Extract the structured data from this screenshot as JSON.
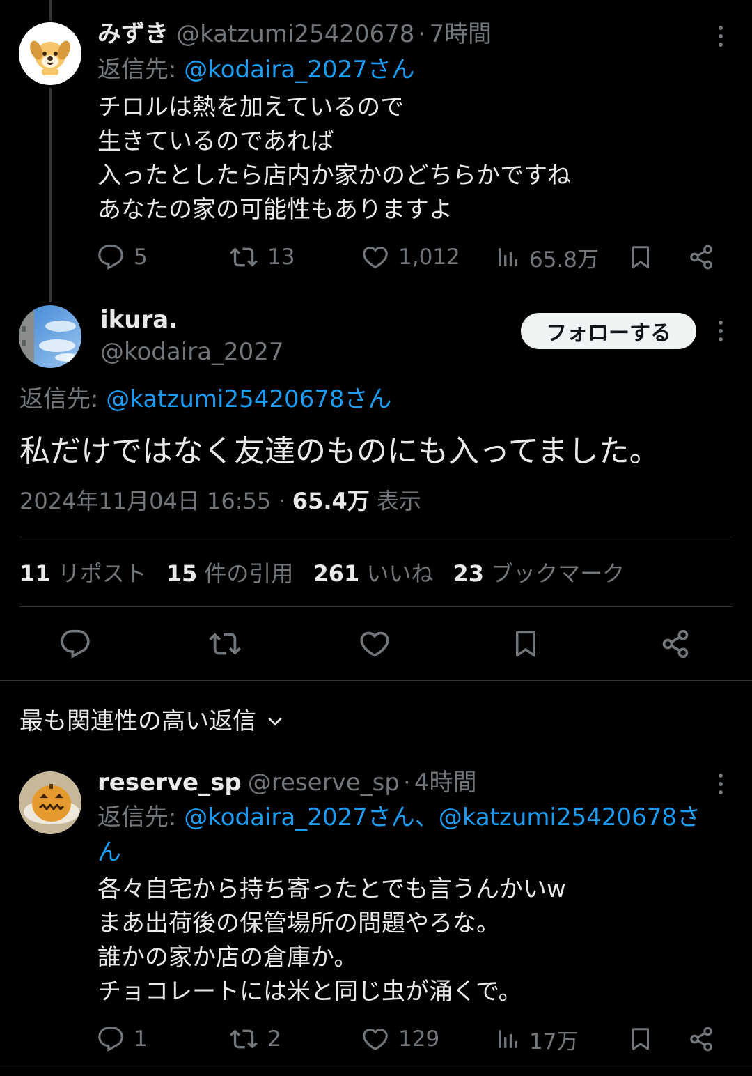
{
  "tweet1": {
    "display_name": "みずき",
    "handle": "@katzumi25420678",
    "separator": "·",
    "time": "7時間",
    "reply_to_label": "返信先: ",
    "reply_to": "@kodaira_2027さん",
    "text": "チロルは熱を加えているので\n生きているのであれば\n入ったとしたら店内か家かのどちらかですね\nあなたの家の可能性もありますよ",
    "replies": "5",
    "reposts": "13",
    "likes": "1,012",
    "views": "65.8万"
  },
  "main_tweet": {
    "display_name": "ikura.",
    "handle": "@kodaira_2027",
    "follow_label": "フォローする",
    "reply_to_label": "返信先: ",
    "reply_to": "@katzumi25420678さん",
    "text": "私だけではなく友達のものにも入ってました。",
    "timestamp": "2024年11月04日 16:55",
    "separator": "·",
    "views": "65.4万",
    "views_label": "表示",
    "stats": [
      {
        "num": "11",
        "label": "リポスト"
      },
      {
        "num": "15",
        "label": "件の引用"
      },
      {
        "num": "261",
        "label": "いいね"
      },
      {
        "num": "23",
        "label": "ブックマーク"
      }
    ]
  },
  "sort": {
    "label": "最も関連性の高い返信"
  },
  "reply1": {
    "display_name": "reserve_sp",
    "handle": "@reserve_sp",
    "separator": "·",
    "time": "4時間",
    "reply_to_label": "返信先: ",
    "reply_to_line1": "@kodaira_2027さん、@katzumi25420678さ",
    "reply_to_line2": "ん",
    "text": "各々自宅から持ち寄ったとでも言うんかいw\nまあ出荷後の保管場所の問題やろな。\n誰かの家か店の倉庫か。\nチョコレートには米と同じ虫が涌くで。",
    "replies": "1",
    "reposts": "2",
    "likes": "129",
    "views": "17万"
  },
  "colors": {
    "background": "#000000",
    "text": "#e7e9ea",
    "muted": "#71767b",
    "link": "#1d9bf0",
    "divider": "#2f3336"
  },
  "icons": [
    "more-icon",
    "reply-icon",
    "repost-icon",
    "like-icon",
    "views-icon",
    "bookmark-icon",
    "share-icon",
    "chevron-down-icon"
  ]
}
